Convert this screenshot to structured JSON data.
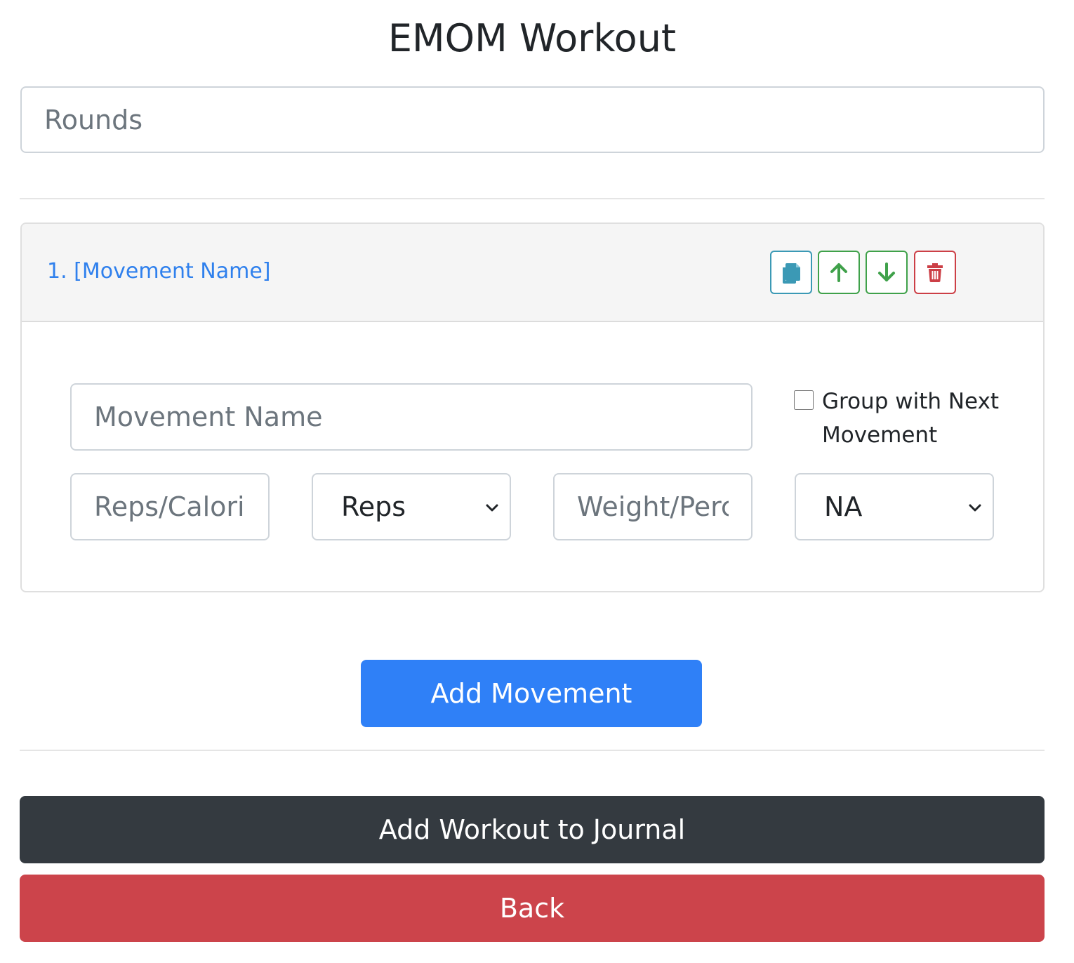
{
  "page": {
    "title": "EMOM Workout"
  },
  "rounds": {
    "placeholder": "Rounds",
    "value": ""
  },
  "movement_card": {
    "title": "1. [Movement Name]",
    "actions": {
      "copy_icon": "copy-icon",
      "up_icon": "arrow-up-icon",
      "down_icon": "arrow-down-icon",
      "delete_icon": "trash-icon"
    },
    "name_field": {
      "placeholder": "Movement Name",
      "value": ""
    },
    "group_checkbox": {
      "label": "Group with Next Movement",
      "checked": false
    },
    "reps_field": {
      "placeholder": "Reps/Calories",
      "value": ""
    },
    "reps_unit": {
      "selected": "Reps"
    },
    "weight_field": {
      "placeholder": "Weight/Percentage",
      "value": ""
    },
    "weight_unit": {
      "selected": "NA"
    }
  },
  "buttons": {
    "add_movement": "Add Movement",
    "add_to_journal": "Add Workout to Journal",
    "back": "Back"
  },
  "colors": {
    "primary": "#2f80f7",
    "dark": "#343a40",
    "danger": "#cc444b",
    "info": "#3b99b5",
    "success": "#3fa14a",
    "link": "#2f80ed"
  }
}
